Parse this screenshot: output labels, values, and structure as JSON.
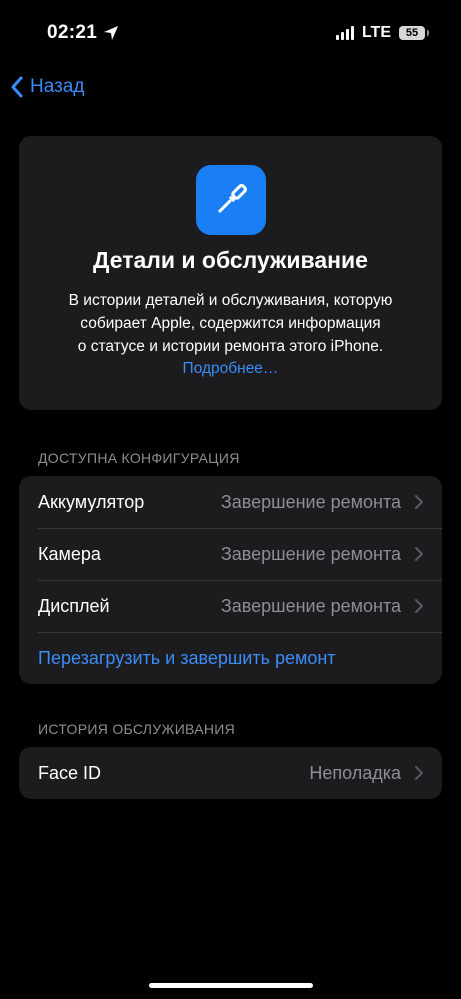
{
  "status_bar": {
    "time": "02:21",
    "network": "LTE",
    "battery": "55"
  },
  "nav": {
    "back_label": "Назад"
  },
  "hero": {
    "title": "Детали и обслуживание",
    "description_lines": [
      "В истории деталей и обслуживания, которую",
      "собирает Apple, содержится информация",
      "о статусе и истории ремонта этого iPhone."
    ],
    "link": "Подробнее…",
    "icon": "screwdriver-icon"
  },
  "config_section": {
    "header": "ДОСТУПНА КОНФИГУРАЦИЯ",
    "rows": [
      {
        "label": "Аккумулятор",
        "value": "Завершение ремонта"
      },
      {
        "label": "Камера",
        "value": "Завершение ремонта"
      },
      {
        "label": "Дисплей",
        "value": "Завершение ремонта"
      }
    ],
    "action": "Перезагрузить и завершить ремонт"
  },
  "service_section": {
    "header": "ИСТОРИЯ ОБСЛУЖИВАНИЯ",
    "rows": [
      {
        "label": "Face ID",
        "value": "Неполадка"
      }
    ]
  },
  "colors": {
    "accent": "#3a8cf7",
    "card_bg": "#1c1c1e",
    "secondary_text": "#8d8d93"
  }
}
